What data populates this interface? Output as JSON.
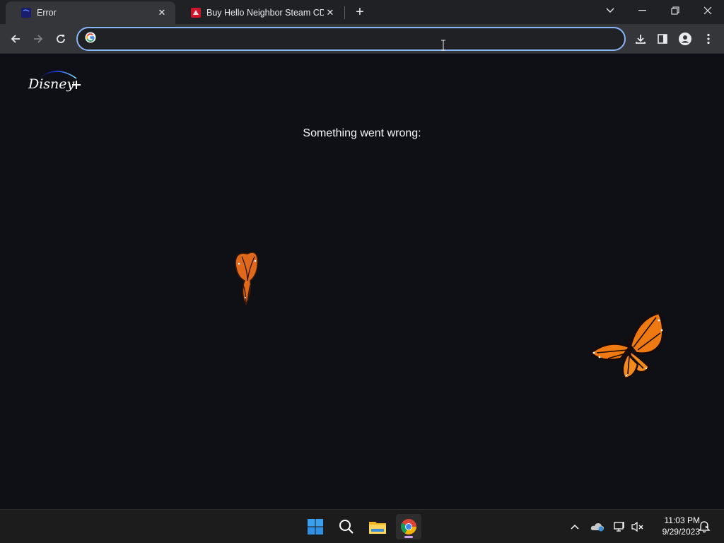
{
  "browser": {
    "tabs": [
      {
        "title": "Error",
        "active": true,
        "favicon": "disney-favicon"
      },
      {
        "title": "Buy Hello Neighbor Steam CD Key",
        "active": false,
        "favicon": "shop-favicon"
      }
    ],
    "omnibox": {
      "value": "",
      "placeholder": ""
    }
  },
  "page": {
    "logo_text": "Disney+",
    "error_message": "Something went wrong:"
  },
  "taskbar": {
    "apps": [
      "start-icon",
      "search-icon",
      "file-explorer-icon",
      "chrome-icon"
    ],
    "clock": {
      "time": "11:03 PM",
      "date": "9/29/2023"
    }
  },
  "colors": {
    "accent": "#8ab4f8",
    "page_bg": "#0e1015",
    "butterfly_orange": "#f07a12"
  }
}
